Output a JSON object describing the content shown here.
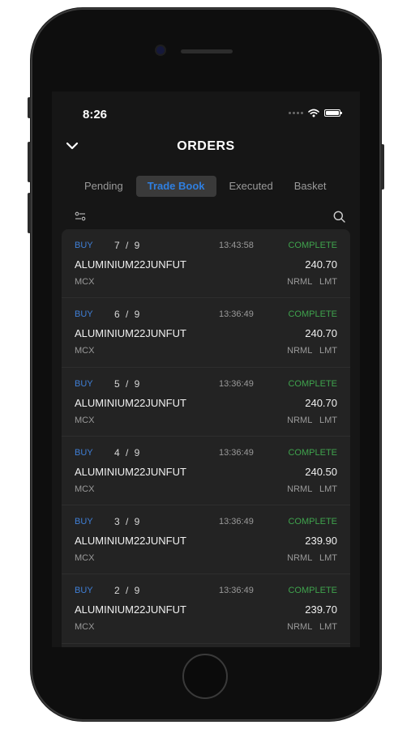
{
  "status_bar": {
    "time": "8:26"
  },
  "header": {
    "title": "ORDERS"
  },
  "tabs": [
    {
      "label": "Pending",
      "active": false
    },
    {
      "label": "Trade Book",
      "active": true
    },
    {
      "label": "Executed",
      "active": false
    },
    {
      "label": "Basket",
      "active": false
    }
  ],
  "orders": [
    {
      "side": "BUY",
      "qty": "7 / 9",
      "time": "13:43:58",
      "status": "COMPLETE",
      "symbol": "ALUMINIUM22JUNFUT",
      "price": "240.70",
      "exchange": "MCX",
      "product": "NRML LMT"
    },
    {
      "side": "BUY",
      "qty": "6 / 9",
      "time": "13:36:49",
      "status": "COMPLETE",
      "symbol": "ALUMINIUM22JUNFUT",
      "price": "240.70",
      "exchange": "MCX",
      "product": "NRML LMT"
    },
    {
      "side": "BUY",
      "qty": "5 / 9",
      "time": "13:36:49",
      "status": "COMPLETE",
      "symbol": "ALUMINIUM22JUNFUT",
      "price": "240.70",
      "exchange": "MCX",
      "product": "NRML LMT"
    },
    {
      "side": "BUY",
      "qty": "4 / 9",
      "time": "13:36:49",
      "status": "COMPLETE",
      "symbol": "ALUMINIUM22JUNFUT",
      "price": "240.50",
      "exchange": "MCX",
      "product": "NRML LMT"
    },
    {
      "side": "BUY",
      "qty": "3 / 9",
      "time": "13:36:49",
      "status": "COMPLETE",
      "symbol": "ALUMINIUM22JUNFUT",
      "price": "239.90",
      "exchange": "MCX",
      "product": "NRML LMT"
    },
    {
      "side": "BUY",
      "qty": "2 / 9",
      "time": "13:36:49",
      "status": "COMPLETE",
      "symbol": "ALUMINIUM22JUNFUT",
      "price": "239.70",
      "exchange": "MCX",
      "product": "NRML LMT"
    }
  ],
  "colors": {
    "buy": "#3f7fd6",
    "complete": "#3fa34d",
    "active_tab": "#2f7fe0",
    "background": "#161616",
    "card": "#232323"
  },
  "icons": {
    "back": "chevron-down-icon",
    "filter": "filter-icon",
    "search": "search-icon",
    "wifi": "wifi-icon",
    "battery": "battery-icon",
    "signal": "signal-icon"
  }
}
